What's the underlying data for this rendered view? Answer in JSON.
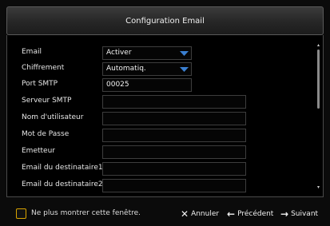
{
  "dialog": {
    "title": "Configuration Email"
  },
  "form": {
    "email": {
      "label": "Email",
      "value": "Activer"
    },
    "encryption": {
      "label": "Chiffrement",
      "value": "Automatiq."
    },
    "smtp_port": {
      "label": "Port SMTP",
      "value": "00025"
    },
    "smtp_server": {
      "label": "Serveur SMTP",
      "value": ""
    },
    "username": {
      "label": "Nom d'utilisateur",
      "value": ""
    },
    "password": {
      "label": "Mot de Passe",
      "value": ""
    },
    "sender": {
      "label": "Emetteur",
      "value": ""
    },
    "recipient1": {
      "label": "Email du destinataire1",
      "value": ""
    },
    "recipient2": {
      "label": "Email du destinataire2",
      "value": ""
    }
  },
  "footer": {
    "dont_show_label": "Ne plus montrer cette fenêtre.",
    "cancel_label": "Annuler",
    "previous_label": "Précédent",
    "next_label": "Suivant"
  },
  "colors": {
    "dropdown_arrow": "#3a7fd0",
    "checkbox_border": "#d9a400"
  }
}
